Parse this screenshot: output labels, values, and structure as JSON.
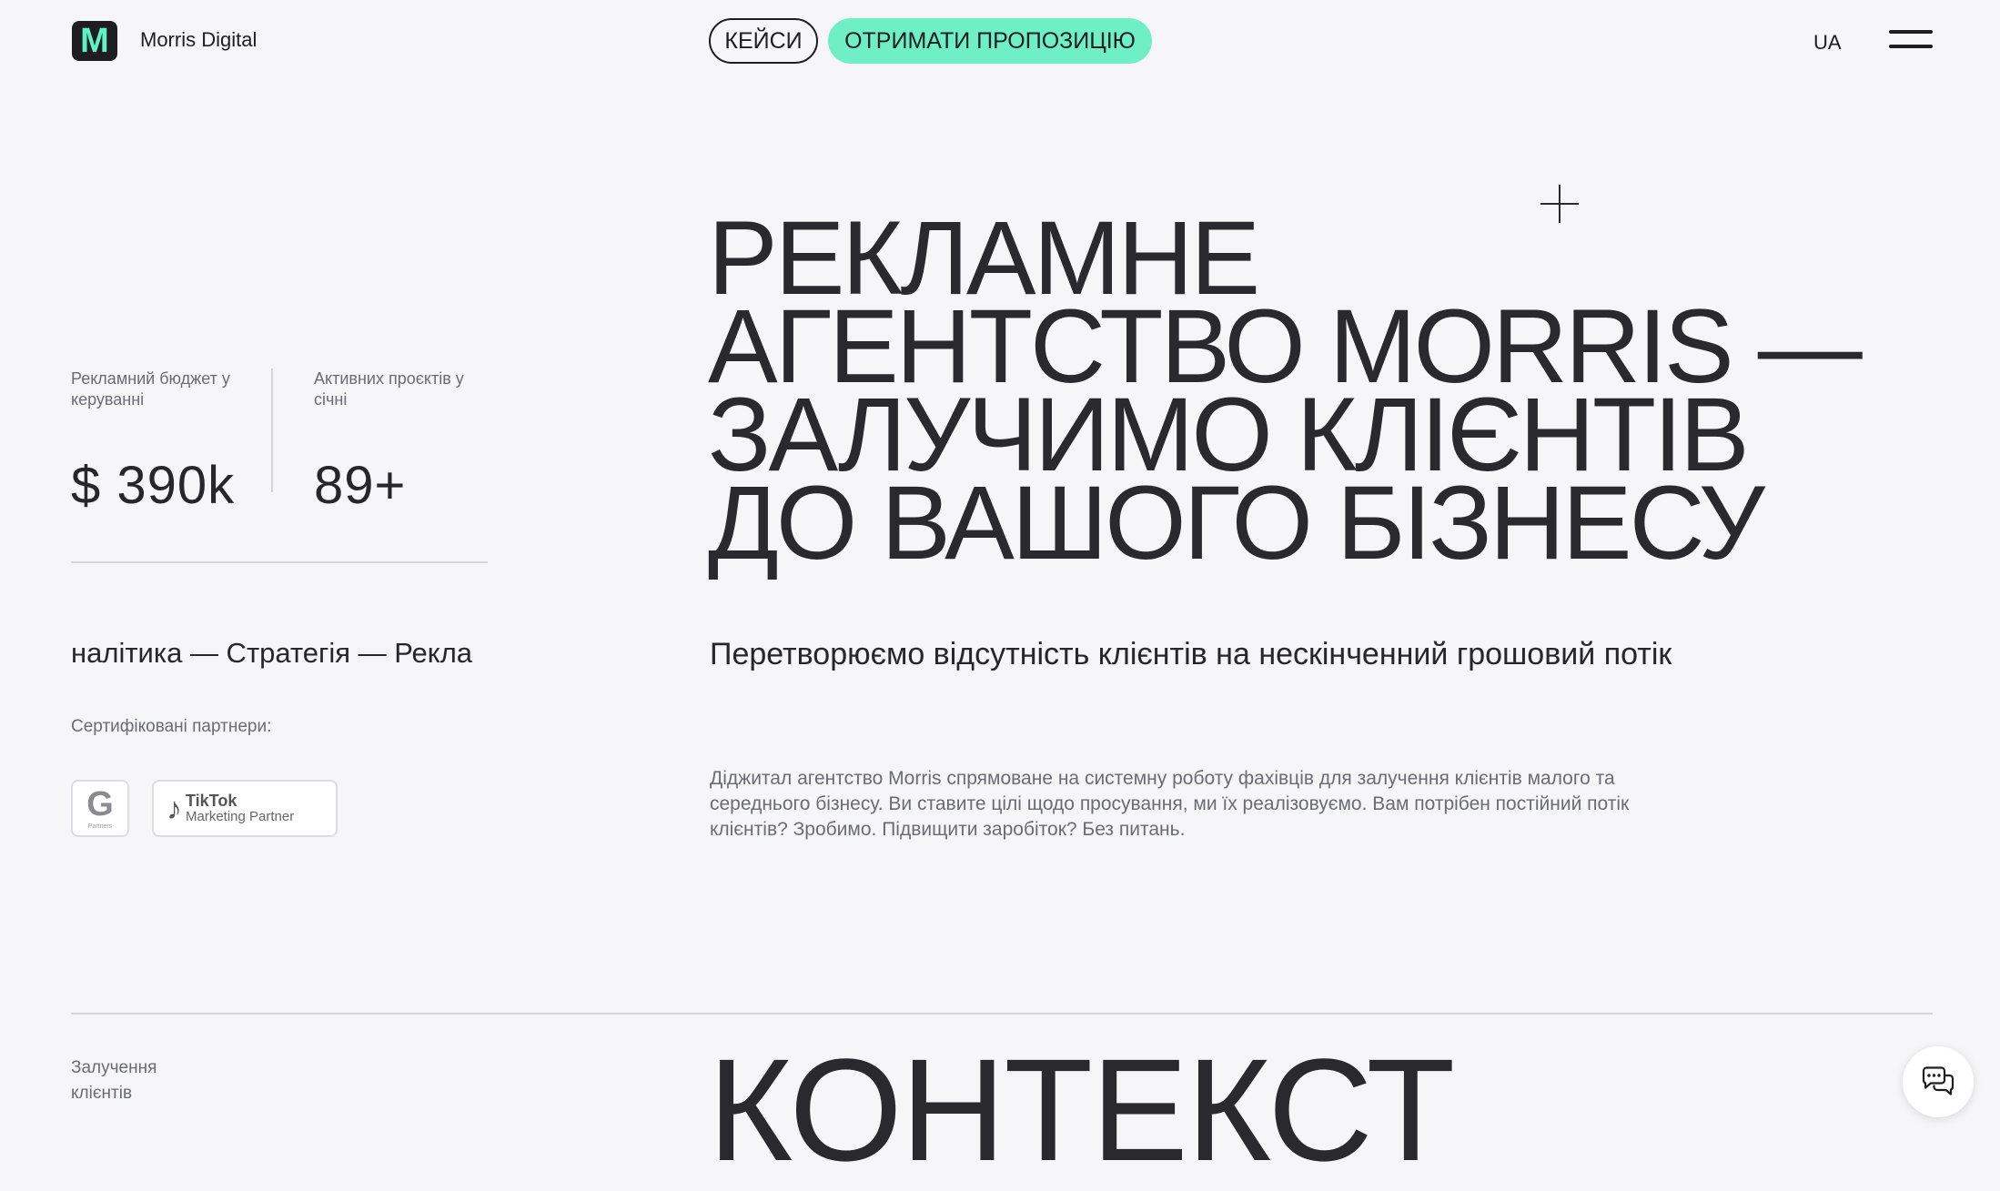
{
  "header": {
    "logo_letter": "M",
    "brand": "Morris Digital",
    "nav_cases": "КЕЙСИ",
    "nav_offer": "ОТРИМАТИ ПРОПОЗИЦІЮ",
    "language": "UA",
    "menu_icon": "hamburger-icon",
    "accent_color": "#6ff0c4"
  },
  "stats": [
    {
      "label": "Рекламний бюджет у керуванні",
      "value": "$ 390k"
    },
    {
      "label": "Активних проєктів у січні",
      "value": "89+"
    }
  ],
  "ticker_text": "налітика — Стратегія — Рекла",
  "partners": {
    "label": "Сертифіковані партнери:",
    "google_letter": "G",
    "google_sub": "Partners",
    "tiktok_line1": "TikTok",
    "tiktok_line2": "Marketing Partner"
  },
  "hero": {
    "title_lines": [
      "Рекламне",
      "агентство Morris —",
      "залучимо клієнтів",
      "до вашого бізнесу"
    ],
    "subtitle": "Перетворюємо відсутність клієнтів на нескінченний грошовий потік",
    "description": "Діджитал агентство Morris спрямоване на системну роботу фахівців для залучення клієнтів малого та середнього бізнесу. Ви ставите цілі щодо просування, ми їх реалізовуємо. Вам потрібен постійний потік клієнтів? Зробимо. Підвищити заробіток? Без питань."
  },
  "next_section": {
    "label": "Залучення клієнтів",
    "title": "КОНТЕКСТ"
  },
  "chat": {
    "icon": "chat-bubbles-icon"
  }
}
